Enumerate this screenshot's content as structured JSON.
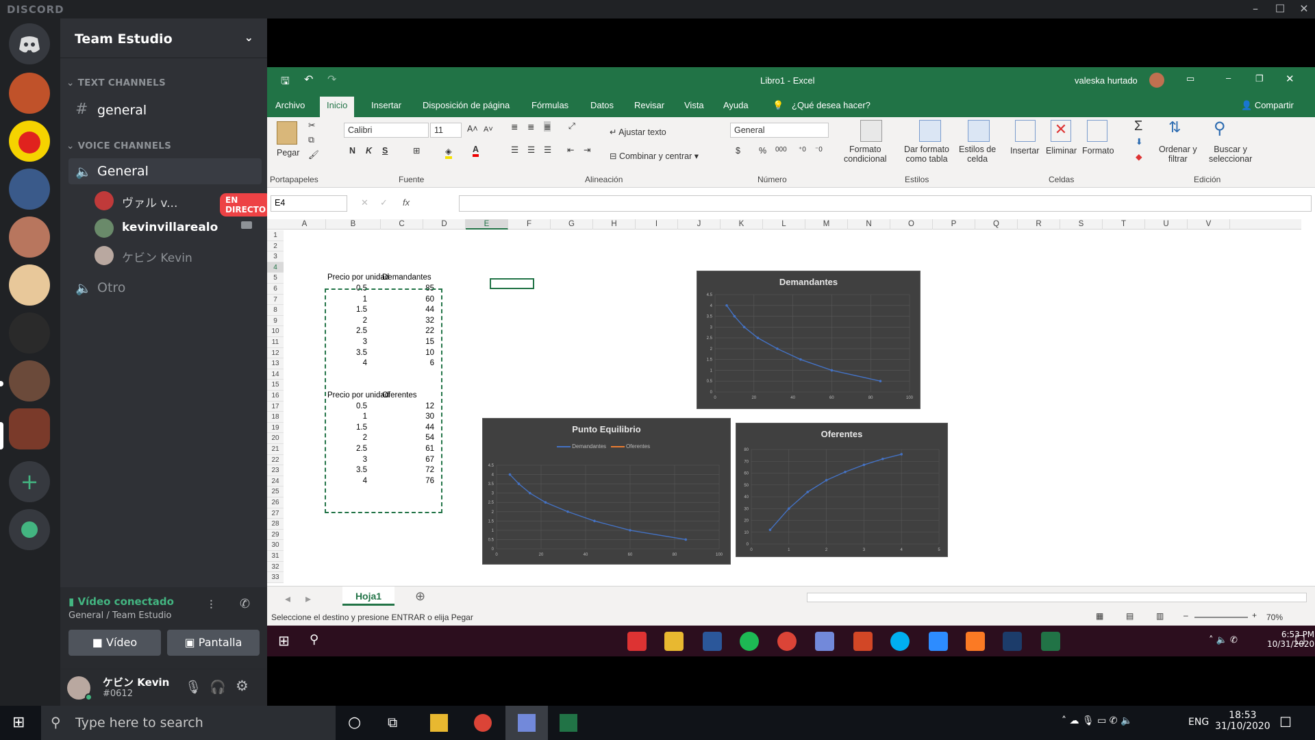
{
  "discord": {
    "brand": "DISCORD",
    "server_name": "Team Estudio",
    "categories": {
      "text": "TEXT CHANNELS",
      "voice": "VOICE CHANNELS"
    },
    "text_channels": [
      {
        "name": "general"
      }
    ],
    "voice_channels": [
      {
        "name": "General"
      },
      {
        "name": "Otro"
      }
    ],
    "voice_users": [
      {
        "name": "ヴァル v...",
        "badge": "EN DIRECTO"
      },
      {
        "name": "kevinvillarealo"
      },
      {
        "name": "ケビン Kevin"
      }
    ],
    "voice_panel": {
      "status": "Vídeo conectado",
      "location": "General / Team Estudio",
      "video_label": "Vídeo",
      "screen_label": "Pantalla"
    },
    "user_panel": {
      "name": "ケビン Kevin",
      "tag": "#0612"
    },
    "colors": {
      "accent": "#43b581",
      "live": "#ed4245",
      "sidebar": "#2f3136",
      "rail": "#202225"
    }
  },
  "excel": {
    "title": "Libro1 - Excel",
    "user": "valeska hurtado",
    "tabs": [
      "Archivo",
      "Inicio",
      "Insertar",
      "Disposición de página",
      "Fórmulas",
      "Datos",
      "Revisar",
      "Vista",
      "Ayuda",
      "¿Qué desea hacer?"
    ],
    "active_tab": "Inicio",
    "share": "Compartir",
    "ribbon": {
      "paste": "Pegar",
      "font_name": "Calibri",
      "font_size": "11",
      "bold": "N",
      "italic": "K",
      "underline": "S",
      "wrap": "Ajustar texto",
      "merge": "Combinar y centrar",
      "number_format": "General",
      "currency": "$",
      "percent": "%",
      "thousands": "000",
      "cond_format": [
        "Formato",
        "condicional"
      ],
      "table_format": [
        "Dar formato",
        "como tabla"
      ],
      "cell_styles": [
        "Estilos de",
        "celda"
      ],
      "insert": "Insertar",
      "delete": "Eliminar",
      "format": "Formato",
      "sort": [
        "Ordenar y",
        "filtrar"
      ],
      "find": [
        "Buscar y",
        "seleccionar"
      ],
      "groups": [
        "Portapapeles",
        "Fuente",
        "Alineación",
        "Número",
        "Estilos",
        "Celdas",
        "Edición"
      ]
    },
    "name_box": "E4",
    "fx": "fx",
    "columns": [
      "A",
      "B",
      "C",
      "D",
      "E",
      "F",
      "G",
      "H",
      "I",
      "J",
      "K",
      "L",
      "M",
      "N",
      "O",
      "P",
      "Q",
      "R",
      "S",
      "T",
      "U",
      "V"
    ],
    "rows": [
      "1",
      "2",
      "3",
      "4",
      "5",
      "6",
      "7",
      "8",
      "9",
      "10",
      "11",
      "12",
      "13",
      "14",
      "15",
      "16",
      "17",
      "18",
      "19",
      "20",
      "21",
      "22",
      "23",
      "24",
      "25",
      "26",
      "27",
      "28",
      "29",
      "30",
      "31",
      "32",
      "33"
    ],
    "table1": {
      "headers": [
        "Precio por unidad",
        "Demandantes"
      ],
      "rows": [
        [
          "0.5",
          "85"
        ],
        [
          "1",
          "60"
        ],
        [
          "1.5",
          "44"
        ],
        [
          "2",
          "32"
        ],
        [
          "2.5",
          "22"
        ],
        [
          "3",
          "15"
        ],
        [
          "3.5",
          "10"
        ],
        [
          "4",
          "6"
        ]
      ]
    },
    "table2": {
      "headers": [
        "Precio por unidad",
        "Oferentes"
      ],
      "rows": [
        [
          "0.5",
          "12"
        ],
        [
          "1",
          "30"
        ],
        [
          "1.5",
          "44"
        ],
        [
          "2",
          "54"
        ],
        [
          "2.5",
          "61"
        ],
        [
          "3",
          "67"
        ],
        [
          "3.5",
          "72"
        ],
        [
          "4",
          "76"
        ]
      ]
    },
    "sheet_tab": "Hoja1",
    "status": "Seleccione el destino y presione ENTRAR o elija Pegar",
    "zoom": "70%",
    "colors": {
      "brand": "#217346",
      "chart_bg": "#404040",
      "series": "#4472c4",
      "series2": "#ed7d31"
    }
  },
  "chart_data": [
    {
      "type": "scatter",
      "title": "Demandantes",
      "x": [
        85,
        60,
        44,
        32,
        22,
        15,
        10,
        6
      ],
      "y": [
        0.5,
        1,
        1.5,
        2,
        2.5,
        3,
        3.5,
        4
      ],
      "xlim": [
        0,
        100
      ],
      "ylim": [
        0,
        4.5
      ],
      "xticks": [
        "0",
        "20",
        "40",
        "60",
        "80",
        "100"
      ],
      "yticks": [
        "0",
        "0.5",
        "1",
        "1.5",
        "2",
        "2.5",
        "3",
        "3.5",
        "4",
        "4.5"
      ]
    },
    {
      "type": "line",
      "title": "Punto Equilibrio",
      "series": [
        {
          "name": "Demandantes",
          "x": [
            85,
            60,
            44,
            32,
            22,
            15,
            10,
            6
          ],
          "y": [
            0.5,
            1,
            1.5,
            2,
            2.5,
            3,
            3.5,
            4
          ]
        },
        {
          "name": "Oferentes",
          "x": [],
          "y": []
        }
      ],
      "xlim": [
        0,
        100
      ],
      "ylim": [
        0,
        4.5
      ],
      "xticks": [
        "0",
        "20",
        "40",
        "60",
        "80",
        "100"
      ],
      "yticks": [
        "0",
        "0.5",
        "1",
        "1.5",
        "2",
        "2.5",
        "3",
        "3.5",
        "4",
        "4.5"
      ],
      "legend": "top"
    },
    {
      "type": "scatter",
      "title": "Oferentes",
      "x": [
        0.5,
        1,
        1.5,
        2,
        2.5,
        3,
        3.5,
        4
      ],
      "y": [
        12,
        30,
        44,
        54,
        61,
        67,
        72,
        76
      ],
      "xlim": [
        0,
        5
      ],
      "ylim": [
        0,
        80
      ],
      "xticks": [
        "0",
        "1",
        "2",
        "3",
        "4",
        "5"
      ],
      "yticks": [
        "0",
        "10",
        "20",
        "30",
        "40",
        "50",
        "60",
        "70",
        "80"
      ]
    }
  ],
  "inner_clock": {
    "time": "6:53 PM",
    "date": "10/31/2020"
  },
  "windows": {
    "search_placeholder": "Type here to search",
    "time": "18:53",
    "date": "31/10/2020",
    "lang": "ENG"
  }
}
